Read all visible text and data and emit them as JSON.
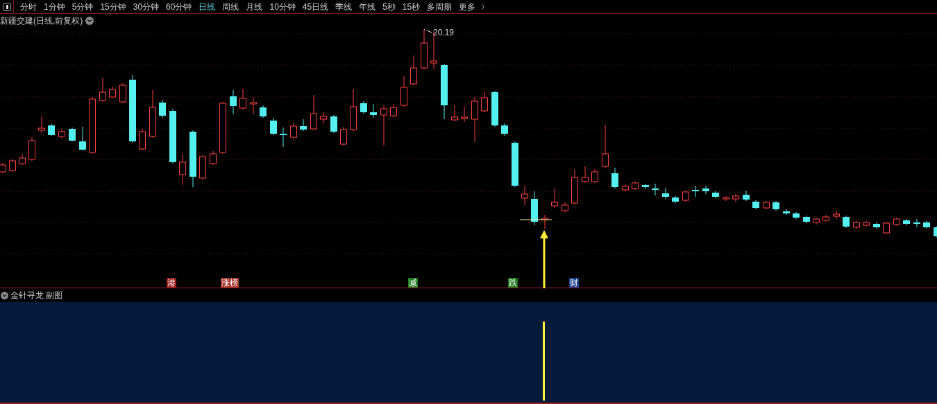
{
  "toolbar": {
    "tabs": [
      {
        "label": "分时",
        "selected": false
      },
      {
        "label": "1分钟",
        "selected": false
      },
      {
        "label": "5分钟",
        "selected": false
      },
      {
        "label": "15分钟",
        "selected": false
      },
      {
        "label": "30分钟",
        "selected": false
      },
      {
        "label": "60分钟",
        "selected": false
      },
      {
        "label": "日线",
        "selected": true
      },
      {
        "label": "周线",
        "selected": false
      },
      {
        "label": "月线",
        "selected": false
      },
      {
        "label": "10分钟",
        "selected": false
      },
      {
        "label": "45日线",
        "selected": false
      },
      {
        "label": "季线",
        "selected": false
      },
      {
        "label": "年线",
        "selected": false
      },
      {
        "label": "5秒",
        "selected": false
      },
      {
        "label": "15秒",
        "selected": false
      },
      {
        "label": "多周期",
        "selected": false
      },
      {
        "label": "更多",
        "selected": false
      }
    ]
  },
  "main_chart": {
    "title": "新疆交建(日线,前复权)",
    "high_label": "20.19",
    "markers": [
      {
        "label": "港",
        "color": "#9b1c1c"
      },
      {
        "label": "涨榜",
        "color": "#a4332a"
      },
      {
        "label": "减",
        "color": "#1f7a1f"
      },
      {
        "label": "跌",
        "color": "#1f7a1f"
      },
      {
        "label": "财",
        "color": "#1e3f8f"
      }
    ]
  },
  "sub_chart": {
    "title": "金针寻龙 副图"
  }
}
